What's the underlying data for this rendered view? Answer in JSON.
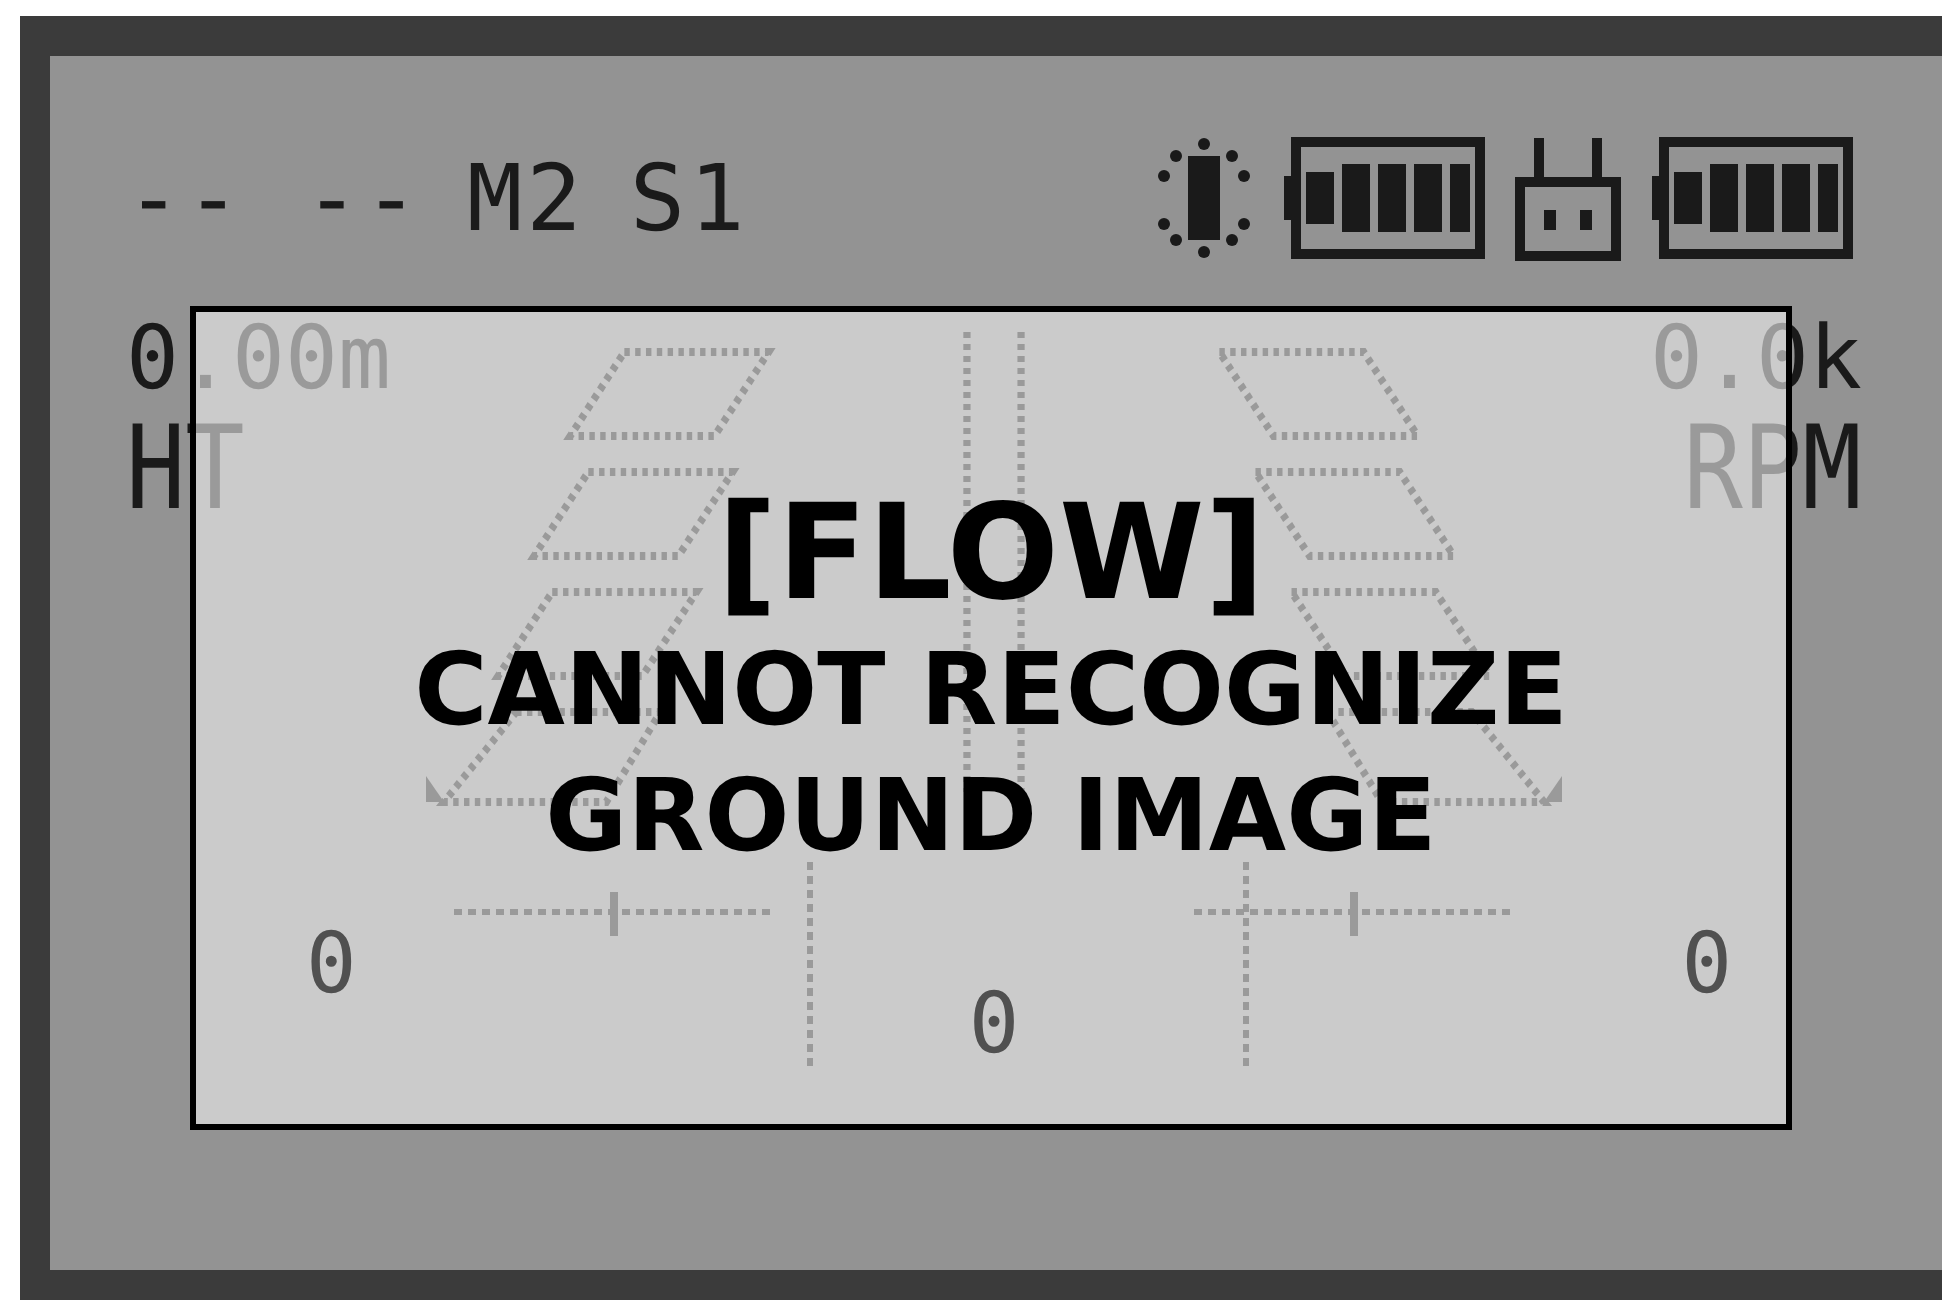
{
  "status": {
    "timer": "-- --",
    "mode": "M2",
    "speed": "S1"
  },
  "left_readout": {
    "value": "0.00m",
    "label": "HT"
  },
  "right_readout": {
    "value": "0.0k",
    "label": "RPM"
  },
  "trim_values": [
    {
      "value": "0"
    },
    {
      "value": "0"
    },
    {
      "value": "0"
    }
  ],
  "dialog": {
    "title": "[FLOW]",
    "message": "CANNOT RECOGNIZE GROUND IMAGE"
  }
}
